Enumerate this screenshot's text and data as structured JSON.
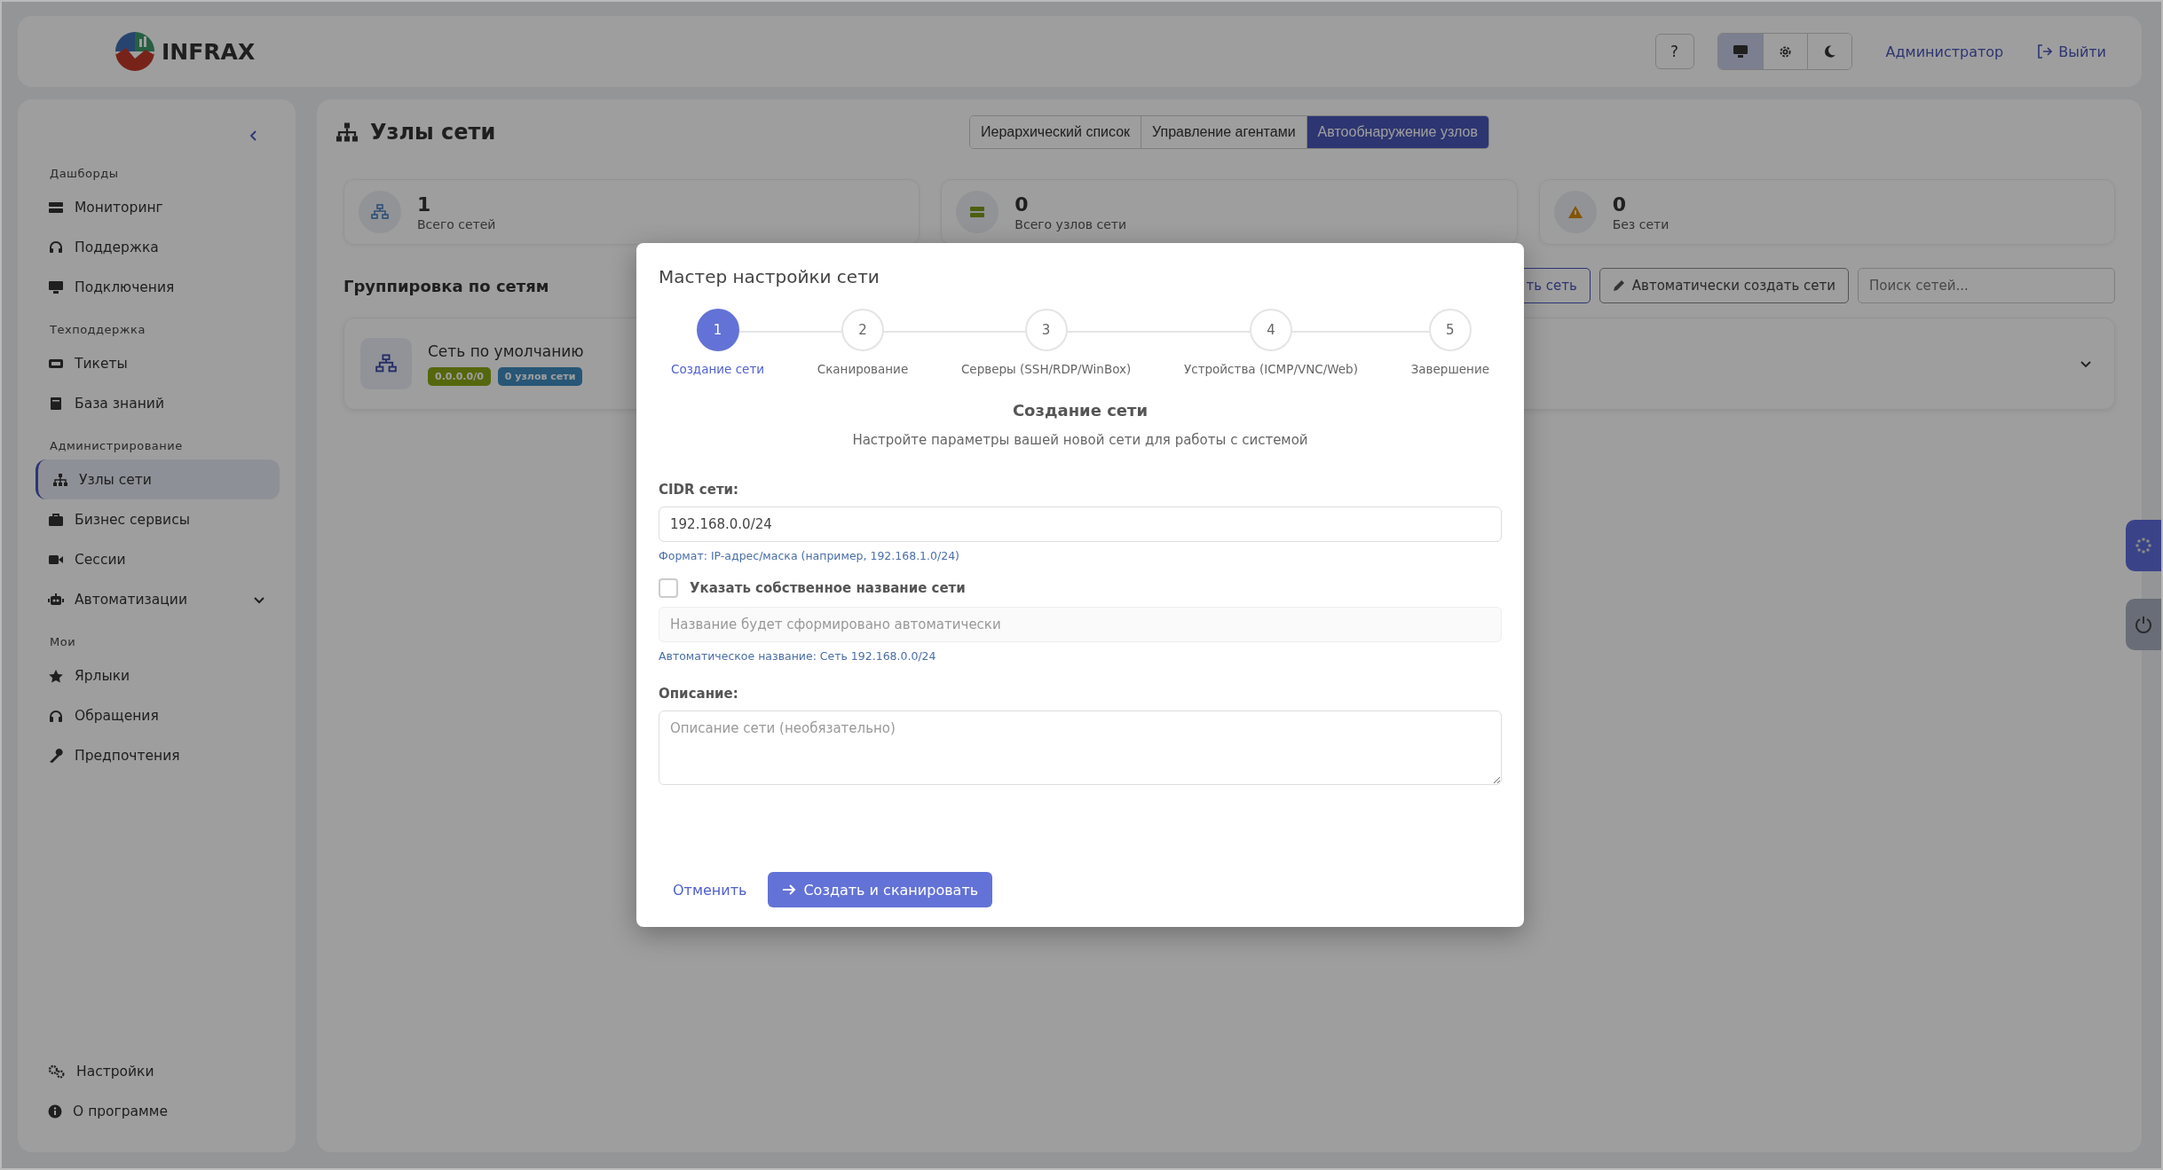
{
  "header": {
    "logo_text": "INFRAX",
    "help_button": "?",
    "theme_modes": [
      {
        "selected": true
      },
      {
        "selected": false
      },
      {
        "selected": false
      }
    ],
    "user": "Администратор",
    "logout": "Выйти"
  },
  "sidebar": {
    "sections": [
      {
        "title": "Дашборды",
        "items": [
          {
            "label": "Мониторинг",
            "selected": false
          },
          {
            "label": "Поддержка",
            "selected": false
          },
          {
            "label": "Подключения",
            "selected": false
          }
        ]
      },
      {
        "title": "Техподдержка",
        "items": [
          {
            "label": "Тикеты",
            "selected": false
          },
          {
            "label": "База знаний",
            "selected": false
          }
        ]
      },
      {
        "title": "Администрирование",
        "items": [
          {
            "label": "Узлы сети",
            "selected": true
          },
          {
            "label": "Бизнес сервисы",
            "selected": false
          },
          {
            "label": "Сессии",
            "selected": false
          },
          {
            "label": "Автоматизации",
            "selected": false,
            "expanded": false
          }
        ]
      },
      {
        "title": "Мои",
        "items": [
          {
            "label": "Ярлыки",
            "selected": false
          },
          {
            "label": "Обращения",
            "selected": false
          },
          {
            "label": "Предпочтения",
            "selected": false
          }
        ]
      }
    ],
    "footer_items": [
      {
        "label": "Настройки"
      },
      {
        "label": "О программе"
      }
    ]
  },
  "main": {
    "title": "Узлы сети",
    "view_tabs": [
      {
        "label": "Иерархический список",
        "selected": false
      },
      {
        "label": "Управление агентами",
        "selected": false
      },
      {
        "label": "Автообнаружение узлов",
        "selected": true
      }
    ],
    "stats": [
      {
        "value": "1",
        "label": "Всего сетей"
      },
      {
        "value": "0",
        "label": "Всего узлов сети"
      },
      {
        "value": "0",
        "label": "Без сети"
      }
    ],
    "group_heading": "Группировка по сетям",
    "add_button": "ть сеть",
    "auto_button": "Автоматически создать сети",
    "search_placeholder": "Поиск сетей...",
    "networks": [
      {
        "name": "Сеть по умолчанию",
        "cidr": "0.0.0.0/0",
        "nodes": "0 узлов сети",
        "expanded": false
      }
    ]
  },
  "modal": {
    "title": "Мастер настройки сети",
    "steps": [
      {
        "number": "1",
        "label": "Создание сети",
        "selected": true
      },
      {
        "number": "2",
        "label": "Сканирование",
        "selected": false
      },
      {
        "number": "3",
        "label": "Серверы (SSH/RDP/WinBox)",
        "selected": false
      },
      {
        "number": "4",
        "label": "Устройства (ICMP/VNC/Web)",
        "selected": false
      },
      {
        "number": "5",
        "label": "Завершение",
        "selected": false
      }
    ],
    "step_title": "Создание сети",
    "step_subtitle": "Настройте параметры вашей новой сети для работы с системой",
    "cidr_label": "CIDR сети:",
    "cidr_value": "192.168.0.0/24",
    "cidr_hint": "Формат: IP-адрес/маска (например, 192.168.1.0/24)",
    "custom_name": {
      "label": "Указать собственное название сети",
      "checked": false
    },
    "name_field": {
      "placeholder": "Название будет сформировано автоматически",
      "disabled": true
    },
    "auto_name": "Автоматическое название: Сеть 192.168.0.0/24",
    "description_label": "Описание:",
    "description_placeholder": "Описание сети (необязательно)",
    "cancel": "Отменить",
    "submit": "Создать и сканировать"
  }
}
